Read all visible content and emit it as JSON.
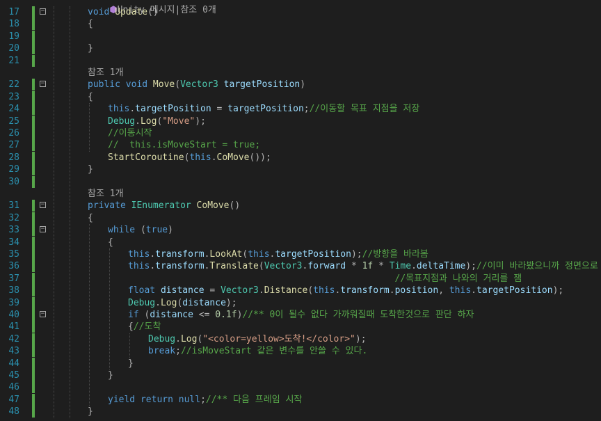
{
  "top_hint": "Unity 메시지|참조 0개",
  "editor": {
    "rows": [
      {
        "row": 0,
        "n": "17",
        "fold": "−",
        "indent": 0,
        "parts": [
          [
            "kw",
            "void "
          ],
          [
            "fn",
            "Update"
          ],
          [
            "op",
            "()"
          ]
        ]
      },
      {
        "row": 1,
        "n": "18",
        "indent": 0,
        "parts": [
          [
            "op",
            "{"
          ]
        ]
      },
      {
        "row": 2,
        "n": "19",
        "indent": 0,
        "parts": []
      },
      {
        "row": 3,
        "n": "20",
        "indent": 0,
        "parts": [
          [
            "op",
            "}"
          ]
        ]
      },
      {
        "row": 4,
        "n": "21",
        "indent": 0,
        "parts": []
      },
      {
        "row": 5,
        "ref": "참조 1개"
      },
      {
        "row": 6,
        "n": "22",
        "fold": "−",
        "indent": 0,
        "parts": [
          [
            "kw",
            "public void "
          ],
          [
            "fn",
            "Move"
          ],
          [
            "op",
            "("
          ],
          [
            "ty",
            "Vector3"
          ],
          [
            "var",
            " targetPosition"
          ],
          [
            "op",
            ")"
          ]
        ]
      },
      {
        "row": 7,
        "n": "23",
        "indent": 0,
        "parts": [
          [
            "op",
            "{"
          ]
        ]
      },
      {
        "row": 8,
        "n": "24",
        "indent": 1,
        "parts": [
          [
            "kw",
            "this"
          ],
          [
            "op",
            "."
          ],
          [
            "var",
            "targetPosition"
          ],
          [
            "op",
            " = "
          ],
          [
            "var",
            "targetPosition"
          ],
          [
            "op",
            ";"
          ],
          [
            "cm",
            "//이동할 목표 지점을 저장"
          ]
        ]
      },
      {
        "row": 9,
        "n": "25",
        "indent": 1,
        "parts": [
          [
            "ty",
            "Debug"
          ],
          [
            "op",
            "."
          ],
          [
            "fn",
            "Log"
          ],
          [
            "op",
            "("
          ],
          [
            "str",
            "\"Move\""
          ],
          [
            "op",
            ");"
          ]
        ]
      },
      {
        "row": 10,
        "n": "26",
        "indent": 1,
        "parts": [
          [
            "cm",
            "//이동시작"
          ]
        ]
      },
      {
        "row": 11,
        "n": "27",
        "indent": 1,
        "parts": [
          [
            "cm",
            "//  this.isMoveStart = true;"
          ]
        ]
      },
      {
        "row": 12,
        "n": "28",
        "indent": 1,
        "parts": [
          [
            "fn",
            "StartCoroutine"
          ],
          [
            "op",
            "("
          ],
          [
            "kw",
            "this"
          ],
          [
            "op",
            "."
          ],
          [
            "fn",
            "CoMove"
          ],
          [
            "op",
            "());"
          ]
        ]
      },
      {
        "row": 13,
        "n": "29",
        "indent": 0,
        "parts": [
          [
            "op",
            "}"
          ]
        ]
      },
      {
        "row": 14,
        "n": "30",
        "indent": 0,
        "parts": []
      },
      {
        "row": 15,
        "ref": "참조 1개"
      },
      {
        "row": 16,
        "n": "31",
        "fold": "−",
        "indent": 0,
        "parts": [
          [
            "kw",
            "private "
          ],
          [
            "ty",
            "IEnumerator"
          ],
          [
            "fn",
            " CoMove"
          ],
          [
            "op",
            "()"
          ]
        ]
      },
      {
        "row": 17,
        "n": "32",
        "indent": 0,
        "parts": [
          [
            "op",
            "{"
          ]
        ]
      },
      {
        "row": 18,
        "n": "33",
        "fold": "−",
        "indent": 1,
        "parts": [
          [
            "kw",
            "while"
          ],
          [
            "op",
            " ("
          ],
          [
            "kw",
            "true"
          ],
          [
            "op",
            ")"
          ]
        ]
      },
      {
        "row": 19,
        "n": "34",
        "indent": 1,
        "parts": [
          [
            "op",
            "{"
          ]
        ]
      },
      {
        "row": 20,
        "n": "35",
        "indent": 2,
        "parts": [
          [
            "kw",
            "this"
          ],
          [
            "op",
            "."
          ],
          [
            "var",
            "transform"
          ],
          [
            "op",
            "."
          ],
          [
            "fn",
            "LookAt"
          ],
          [
            "op",
            "("
          ],
          [
            "kw",
            "this"
          ],
          [
            "op",
            "."
          ],
          [
            "var",
            "targetPosition"
          ],
          [
            "op",
            ");"
          ],
          [
            "cm",
            "//방향을 바라봄"
          ]
        ]
      },
      {
        "row": 21,
        "n": "36",
        "indent": 2,
        "parts": [
          [
            "kw",
            "this"
          ],
          [
            "op",
            "."
          ],
          [
            "var",
            "transform"
          ],
          [
            "op",
            "."
          ],
          [
            "fn",
            "Translate"
          ],
          [
            "op",
            "("
          ],
          [
            "ty",
            "Vector3"
          ],
          [
            "op",
            "."
          ],
          [
            "var",
            "forward"
          ],
          [
            "op",
            " * "
          ],
          [
            "num",
            "1f"
          ],
          [
            "op",
            " * "
          ],
          [
            "ty",
            "Time"
          ],
          [
            "op",
            "."
          ],
          [
            "var",
            "deltaTime"
          ],
          [
            "op",
            ");"
          ],
          [
            "cm",
            "//이미 바라봤으니까 정면으로 이"
          ]
        ]
      },
      {
        "row": 22,
        "n": "37",
        "indent": 2,
        "parts": [
          [
            "op",
            "                                                 "
          ],
          [
            "cm",
            "//목표지점과 나와의 거리를 잼"
          ]
        ]
      },
      {
        "row": 23,
        "n": "38",
        "indent": 2,
        "parts": [
          [
            "kw",
            "float "
          ],
          [
            "var",
            "distance"
          ],
          [
            "op",
            " = "
          ],
          [
            "ty",
            "Vector3"
          ],
          [
            "op",
            "."
          ],
          [
            "fn",
            "Distance"
          ],
          [
            "op",
            "("
          ],
          [
            "kw",
            "this"
          ],
          [
            "op",
            "."
          ],
          [
            "var",
            "transform"
          ],
          [
            "op",
            "."
          ],
          [
            "var",
            "position"
          ],
          [
            "op",
            ", "
          ],
          [
            "kw",
            "this"
          ],
          [
            "op",
            "."
          ],
          [
            "var",
            "targetPosition"
          ],
          [
            "op",
            ");"
          ]
        ]
      },
      {
        "row": 24,
        "n": "39",
        "indent": 2,
        "parts": [
          [
            "ty",
            "Debug"
          ],
          [
            "op",
            "."
          ],
          [
            "fn",
            "Log"
          ],
          [
            "op",
            "("
          ],
          [
            "var",
            "distance"
          ],
          [
            "op",
            ");"
          ]
        ]
      },
      {
        "row": 25,
        "n": "40",
        "fold": "−",
        "indent": 2,
        "parts": [
          [
            "kw",
            "if"
          ],
          [
            "op",
            " ("
          ],
          [
            "var",
            "distance"
          ],
          [
            "op",
            " <= "
          ],
          [
            "num",
            "0.1f"
          ],
          [
            "op",
            ")"
          ],
          [
            "cm",
            "//** 0이 될수 없다 가까워질때 도착한것으로 판단 하자"
          ]
        ]
      },
      {
        "row": 26,
        "n": "41",
        "indent": 2,
        "parts": [
          [
            "op",
            "{"
          ],
          [
            "cm",
            "//도착"
          ]
        ]
      },
      {
        "row": 27,
        "n": "42",
        "indent": 3,
        "parts": [
          [
            "ty",
            "Debug"
          ],
          [
            "op",
            "."
          ],
          [
            "fn",
            "Log"
          ],
          [
            "op",
            "("
          ],
          [
            "str",
            "\"<color=yellow>도착!</color>\""
          ],
          [
            "op",
            ");"
          ]
        ]
      },
      {
        "row": 28,
        "n": "43",
        "indent": 3,
        "parts": [
          [
            "kw",
            "break"
          ],
          [
            "op",
            ";"
          ],
          [
            "cm",
            "//isMoveStart 같은 변수를 안쓸 수 있다."
          ]
        ]
      },
      {
        "row": 29,
        "n": "44",
        "indent": 2,
        "parts": [
          [
            "op",
            "}"
          ]
        ]
      },
      {
        "row": 30,
        "n": "45",
        "indent": 1,
        "parts": [
          [
            "op",
            "}"
          ]
        ]
      },
      {
        "row": 31,
        "n": "46",
        "indent": 0,
        "parts": []
      },
      {
        "row": 32,
        "n": "47",
        "indent": 1,
        "parts": [
          [
            "kw",
            "yield return null"
          ],
          [
            "op",
            ";"
          ],
          [
            "cm",
            "//** 다음 프레임 시작"
          ]
        ]
      },
      {
        "row": 33,
        "n": "48",
        "indent": 0,
        "parts": [
          [
            "op",
            "}"
          ]
        ]
      }
    ]
  }
}
